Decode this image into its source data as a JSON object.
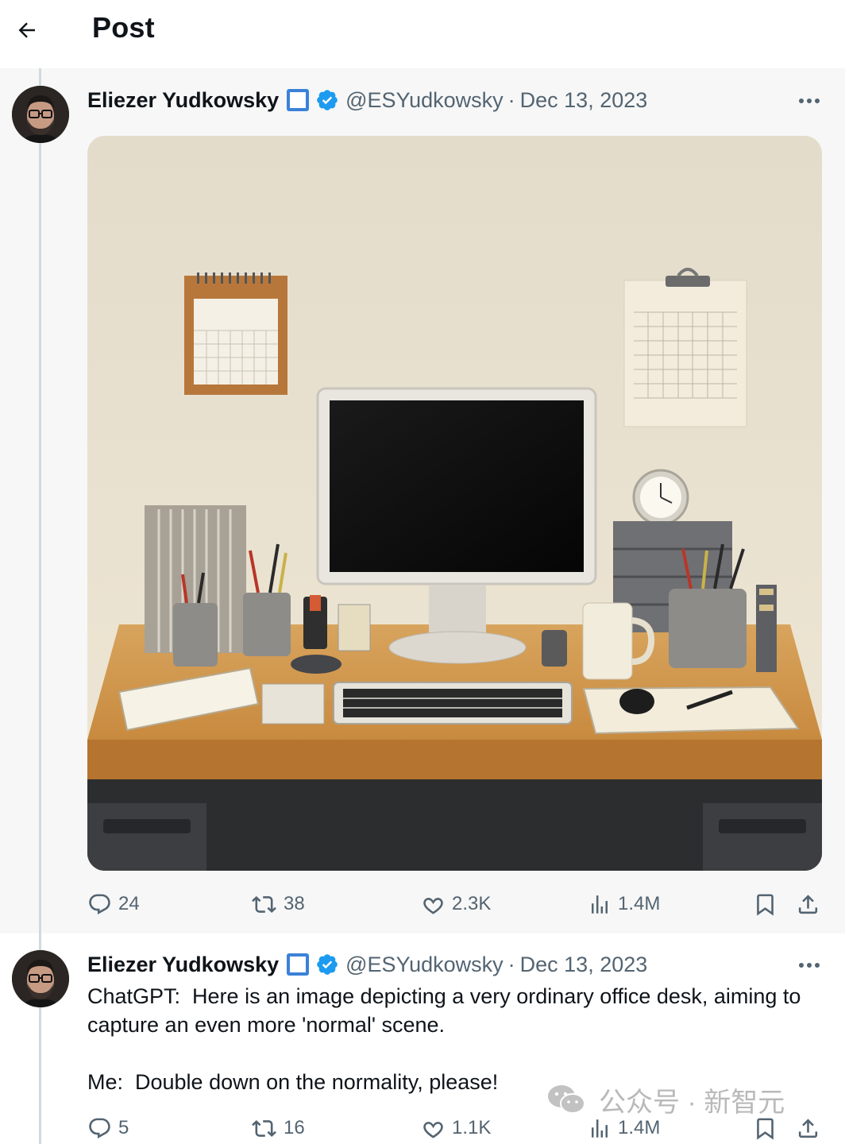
{
  "header": {
    "title": "Post"
  },
  "posts": [
    {
      "author": "Eliezer Yudkowsky",
      "handle": "@ESYudkowsky",
      "dot": "·",
      "date": "Dec 13, 2023",
      "stats": {
        "replies": "24",
        "reposts": "38",
        "likes": "2.3K",
        "views": "1.4M"
      }
    },
    {
      "author": "Eliezer Yudkowsky",
      "handle": "@ESYudkowsky",
      "dot": "·",
      "date": "Dec 13, 2023",
      "text_line1": "ChatGPT:  Here is an image depicting a very ordinary office desk, aiming to capture an even more 'normal' scene.",
      "text_line2": "Me:  Double down on the normality, please!",
      "stats": {
        "replies": "5",
        "reposts": "16",
        "likes": "1.1K",
        "views": "1.4M"
      }
    }
  ],
  "watermark": {
    "text": "公众号 · 新智元"
  },
  "colors": {
    "accent": "#1d9bf0",
    "muted": "#536471",
    "box": "#3a82d8"
  }
}
